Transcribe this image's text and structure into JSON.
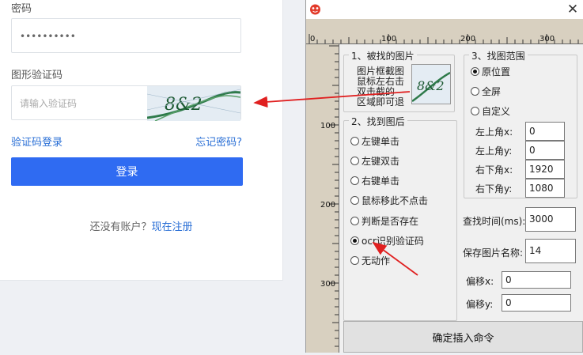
{
  "login": {
    "password_label": "密码",
    "password_value": "••••••••••",
    "captcha_label": "图形验证码",
    "captcha_placeholder": "请输入验证码",
    "captcha_image_text": "8&2",
    "captcha_login_link": "验证码登录",
    "forgot_link": "忘记密码?",
    "login_button": "登录",
    "signup_prompt": "还没有账户？",
    "signup_link": "现在注册"
  },
  "dialog": {
    "hruler_ticks": [
      "0",
      "100",
      "200",
      "300"
    ],
    "vruler_ticks": [
      "100",
      "200",
      "300"
    ],
    "group1": {
      "title": "1、被找的图片",
      "preview_text": "图片框截图 鼠标左右击 双击截的 区域即可退"
    },
    "group2": {
      "title": "2、找到图后",
      "options": [
        "左键单击",
        "左键双击",
        "右键单击",
        "鼠标移此不点击",
        "判断是否存在",
        "ocr识别验证码",
        "无动作"
      ],
      "selected_index": 5
    },
    "group3": {
      "title": "3、找图范围",
      "options": [
        "原位置",
        "全屏",
        "自定义"
      ],
      "selected_index": 0,
      "coords": [
        {
          "label": "左上角x:",
          "value": "0"
        },
        {
          "label": "左上角y:",
          "value": "0"
        },
        {
          "label": "右下角x:",
          "value": "1920"
        },
        {
          "label": "右下角y:",
          "value": "1080"
        }
      ]
    },
    "find_time_label": "查找时间(ms):",
    "find_time_value": "3000",
    "save_name_label": "保存图片名称:",
    "save_name_value": "14",
    "offset_x_label": "偏移x:",
    "offset_x_value": "0",
    "offset_y_label": "偏移y:",
    "offset_y_value": "0",
    "insert_button": "确定插入命令",
    "close_icon": "close-icon",
    "app_icon": "app-icon",
    "accent_arrow_color": "#e02020",
    "ruler_color": "#d8d0c0"
  }
}
